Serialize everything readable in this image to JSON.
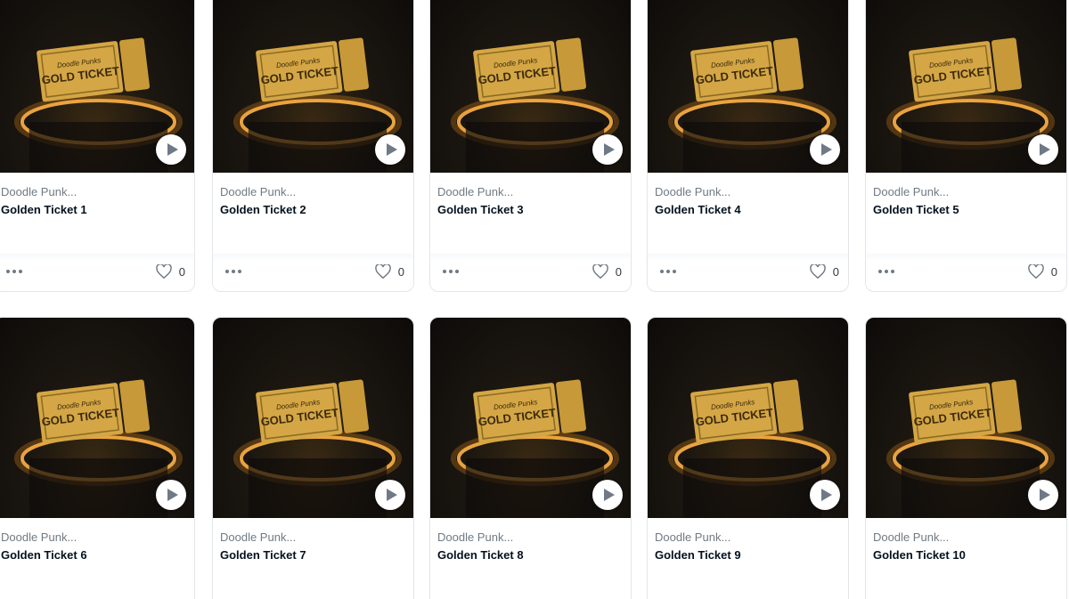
{
  "cards": [
    {
      "collection": "Doodle Punk...",
      "title": "Golden Ticket 1",
      "likes": "0"
    },
    {
      "collection": "Doodle Punk...",
      "title": "Golden Ticket 2",
      "likes": "0"
    },
    {
      "collection": "Doodle Punk...",
      "title": "Golden Ticket 3",
      "likes": "0"
    },
    {
      "collection": "Doodle Punk...",
      "title": "Golden Ticket 4",
      "likes": "0"
    },
    {
      "collection": "Doodle Punk...",
      "title": "Golden Ticket 5",
      "likes": "0"
    },
    {
      "collection": "Doodle Punk...",
      "title": "Golden Ticket 6"
    },
    {
      "collection": "Doodle Punk...",
      "title": "Golden Ticket 7"
    },
    {
      "collection": "Doodle Punk...",
      "title": "Golden Ticket 8"
    },
    {
      "collection": "Doodle Punk...",
      "title": "Golden Ticket 9"
    },
    {
      "collection": "Doodle Punk...",
      "title": "Golden Ticket 10"
    }
  ],
  "artwork": {
    "ticket_header": "Doodle Punks",
    "ticket_text": "GOLD TICKET"
  },
  "icons": {
    "media_action": "play-icon",
    "card_menu": "more-options-icon",
    "favorite": "heart-icon"
  },
  "colors": {
    "gold": "#d4a645",
    "glow": "#ffb347",
    "muted_text": "#707a83",
    "title_text": "#04111d"
  }
}
